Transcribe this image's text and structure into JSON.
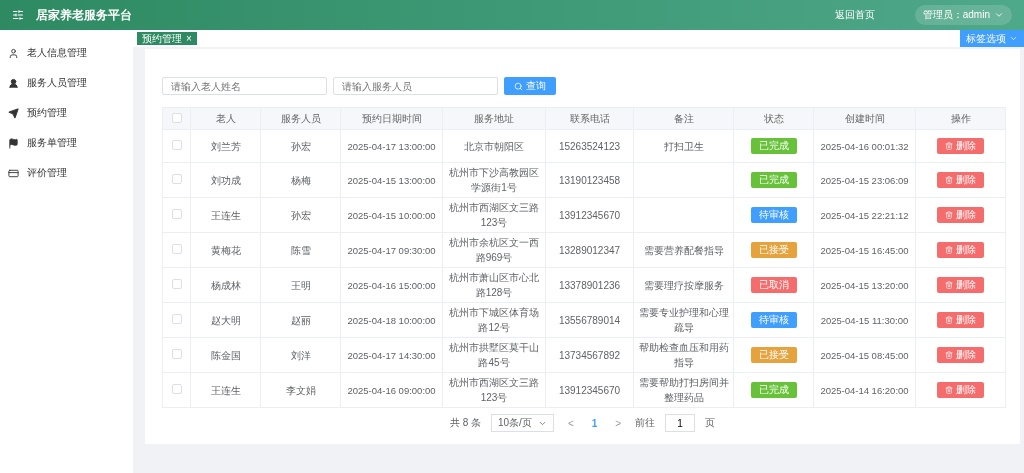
{
  "header": {
    "title": "居家养老服务平台",
    "home_link": "返回首页",
    "user_menu": "管理员：admin"
  },
  "tabs": [
    {
      "label": "预约管理",
      "close": "×",
      "selected": true
    }
  ],
  "tab_options": "标签选项",
  "sidebar": {
    "items": [
      {
        "label": "老人信息管理",
        "selected": false
      },
      {
        "label": "服务人员管理",
        "selected": false
      },
      {
        "label": "预约管理",
        "selected": false
      },
      {
        "label": "服务单管理",
        "selected": false
      },
      {
        "label": "评价管理",
        "selected": false
      }
    ]
  },
  "search": {
    "fields": [
      {
        "placeholder": "请输入老人姓名"
      },
      {
        "placeholder": "请输入服务人员"
      }
    ],
    "button": "查询"
  },
  "table": {
    "select_all": false,
    "columns": [
      "老人",
      "服务人员",
      "预约日期时间",
      "服务地址",
      "联系电话",
      "备注",
      "状态",
      "创建时间",
      "操作"
    ],
    "rows": [
      {
        "checked": false,
        "elder": "刘兰芳",
        "staff": "孙宏",
        "time": "2025-04-17 13:00:00",
        "address": "北京市朝阳区",
        "phone": "15263524123",
        "note": "打扫卫生",
        "status": "已完成",
        "color": "#67c23a",
        "created": "2025-04-16 00:01:32",
        "action": "删除"
      },
      {
        "checked": false,
        "elder": "刘功成",
        "staff": "杨梅",
        "time": "2025-04-15 13:00:00",
        "address": "杭州市下沙高教园区学源街1号",
        "phone": "13190123458",
        "status": "已完成",
        "color": "#67c23a",
        "created": "2025-04-15 23:06:09",
        "action": "删除"
      },
      {
        "checked": false,
        "elder": "王连生",
        "staff": "孙宏",
        "time": "2025-04-15 10:00:00",
        "address": "杭州市西湖区文三路123号",
        "phone": "13912345670",
        "status": "待审核",
        "color": "#409eff",
        "created": "2025-04-15 22:21:12",
        "action": "删除"
      },
      {
        "checked": false,
        "elder": "黄梅花",
        "staff": "陈雪",
        "time": "2025-04-17 09:30:00",
        "address": "杭州市余杭区文一西路969号",
        "phone": "13289012347",
        "note": "需要营养配餐指导",
        "status": "已接受",
        "color": "#e6a23c",
        "created": "2025-04-15 16:45:00",
        "action": "删除"
      },
      {
        "checked": false,
        "elder": "杨成林",
        "staff": "王明",
        "time": "2025-04-16 15:00:00",
        "address": "杭州市萧山区市心北路128号",
        "phone": "13378901236",
        "note": "需要理疗按摩服务",
        "status": "已取消",
        "color": "#f56c6c",
        "created": "2025-04-15 13:20:00",
        "action": "删除"
      },
      {
        "checked": false,
        "elder": "赵大明",
        "staff": "赵丽",
        "time": "2025-04-18 10:00:00",
        "address": "杭州市下城区体育场路12号",
        "phone": "13556789014",
        "note": "需要专业护理和心理疏导",
        "status": "待审核",
        "color": "#409eff",
        "created": "2025-04-15 11:30:00",
        "action": "删除"
      },
      {
        "checked": false,
        "elder": "陈金国",
        "staff": "刘洋",
        "time": "2025-04-17 14:30:00",
        "address": "杭州市拱墅区莫干山路45号",
        "phone": "13734567892",
        "note": "帮助检查血压和用药指导",
        "status": "已接受",
        "color": "#e6a23c",
        "created": "2025-04-15 08:45:00",
        "action": "删除"
      },
      {
        "checked": false,
        "elder": "王连生",
        "staff": "李文娟",
        "time": "2025-04-16 09:00:00",
        "address": "杭州市西湖区文三路123号",
        "phone": "13912345670",
        "note": "需要帮助打扫房间并整理药品",
        "status": "已完成",
        "color": "#67c23a",
        "created": "2025-04-14 16:20:00",
        "action": "删除"
      }
    ]
  },
  "pagination": {
    "total": "共 8 条",
    "page_size": "10条/页",
    "prev": "<",
    "pages": [
      {
        "label": "1",
        "selected": true
      }
    ],
    "next": ">",
    "goto": "前往",
    "goto_value": "1",
    "goto_suffix": "页"
  }
}
